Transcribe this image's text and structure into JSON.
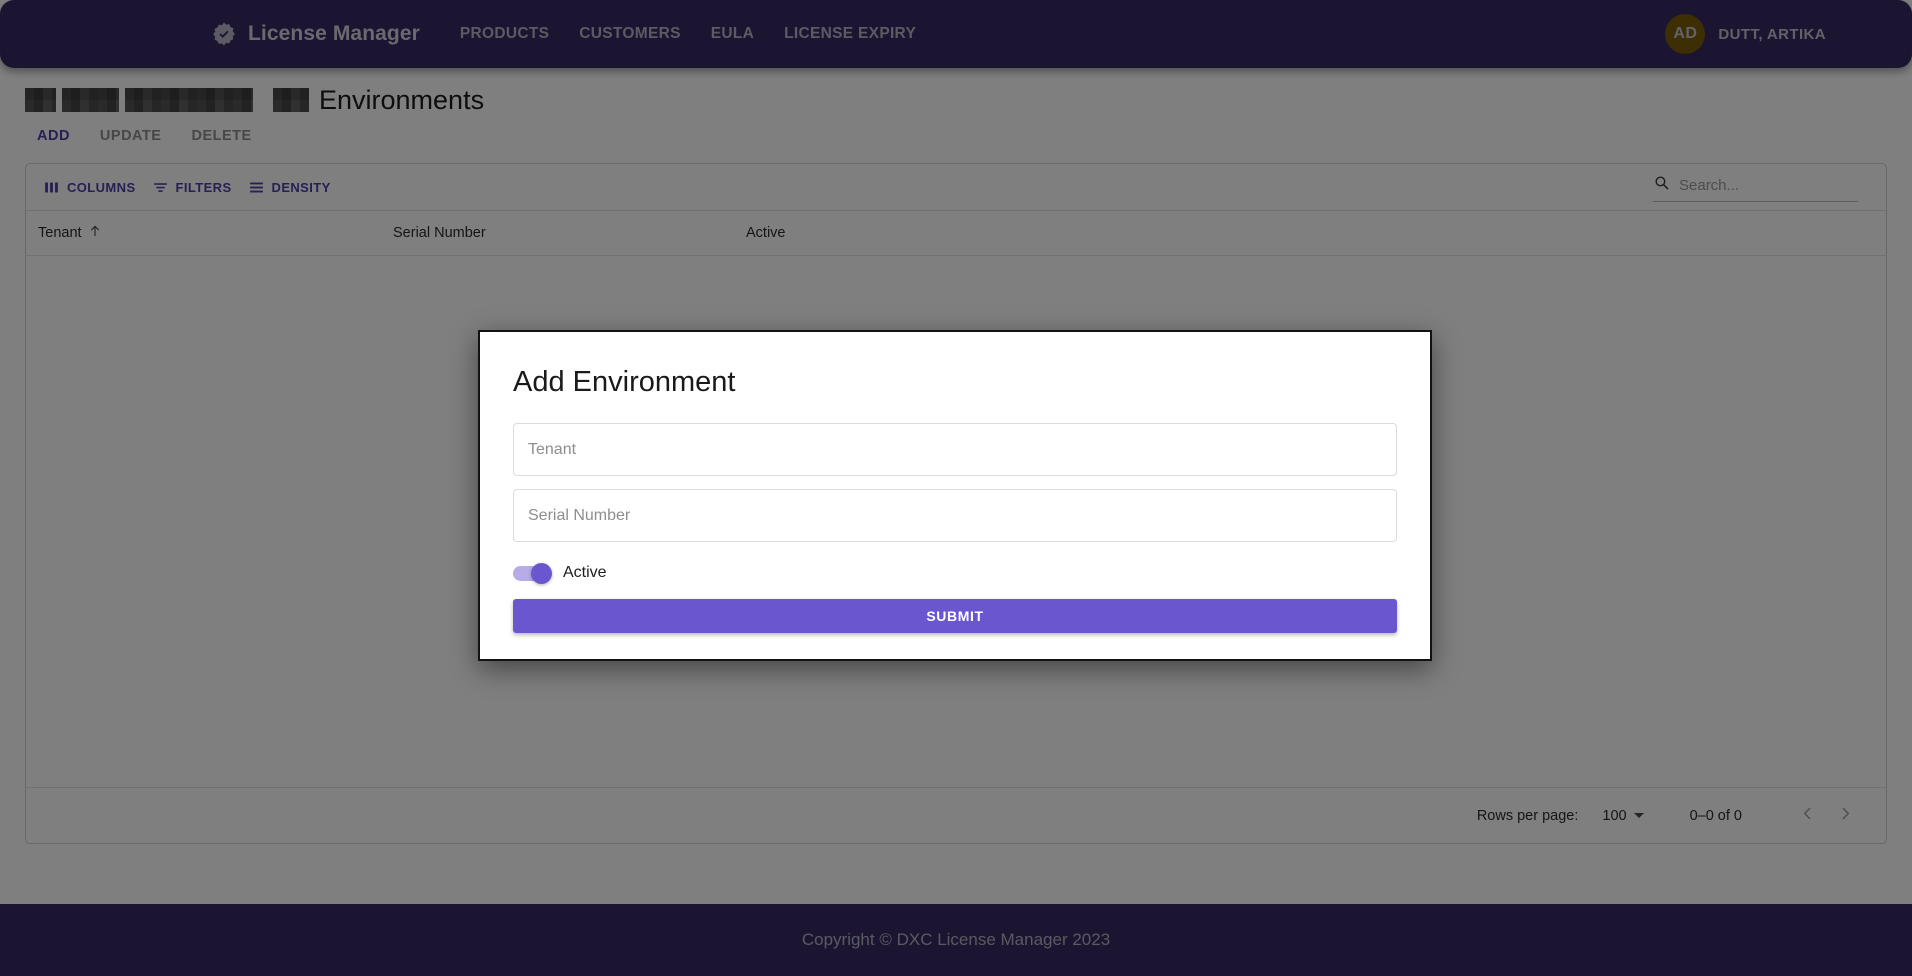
{
  "header": {
    "brand_label": "License Manager",
    "brand_icon": "verified-badge-icon",
    "nav": [
      {
        "label": "PRODUCTS"
      },
      {
        "label": "CUSTOMERS"
      },
      {
        "label": "EULA"
      },
      {
        "label": "LICENSE EXPIRY"
      }
    ],
    "user": {
      "initials": "AD",
      "name": "DUTT, ARTIKA"
    },
    "bar_color": "#372a65"
  },
  "breadcrumb": {
    "redacted": true,
    "page_title": "Environments"
  },
  "tabs": [
    {
      "label": "ADD",
      "active": true
    },
    {
      "label": "UPDATE",
      "active": false
    },
    {
      "label": "DELETE",
      "active": false
    }
  ],
  "grid": {
    "toolbar": {
      "columns_label": "COLUMNS",
      "filters_label": "FILTERS",
      "density_label": "DENSITY"
    },
    "search": {
      "placeholder": "Search...",
      "value": "",
      "icon": "search-icon"
    },
    "columns": [
      {
        "label": "Tenant",
        "sorted": "asc"
      },
      {
        "label": "Serial Number",
        "sorted": ""
      },
      {
        "label": "Active",
        "sorted": ""
      }
    ],
    "rows": [],
    "footer": {
      "rows_per_page_label": "Rows per page:",
      "rows_per_page_value": "100",
      "range_label": "0–0 of 0"
    }
  },
  "modal": {
    "title": "Add Environment",
    "fields": [
      {
        "name": "tenant",
        "placeholder": "Tenant",
        "value": ""
      },
      {
        "name": "serial_number",
        "placeholder": "Serial Number",
        "value": ""
      }
    ],
    "toggle": {
      "label": "Active",
      "on": true
    },
    "submit_label": "SUBMIT",
    "accent_color": "#6a57d0"
  },
  "footer": {
    "copyright": "Copyright © DXC License Manager 2023"
  }
}
